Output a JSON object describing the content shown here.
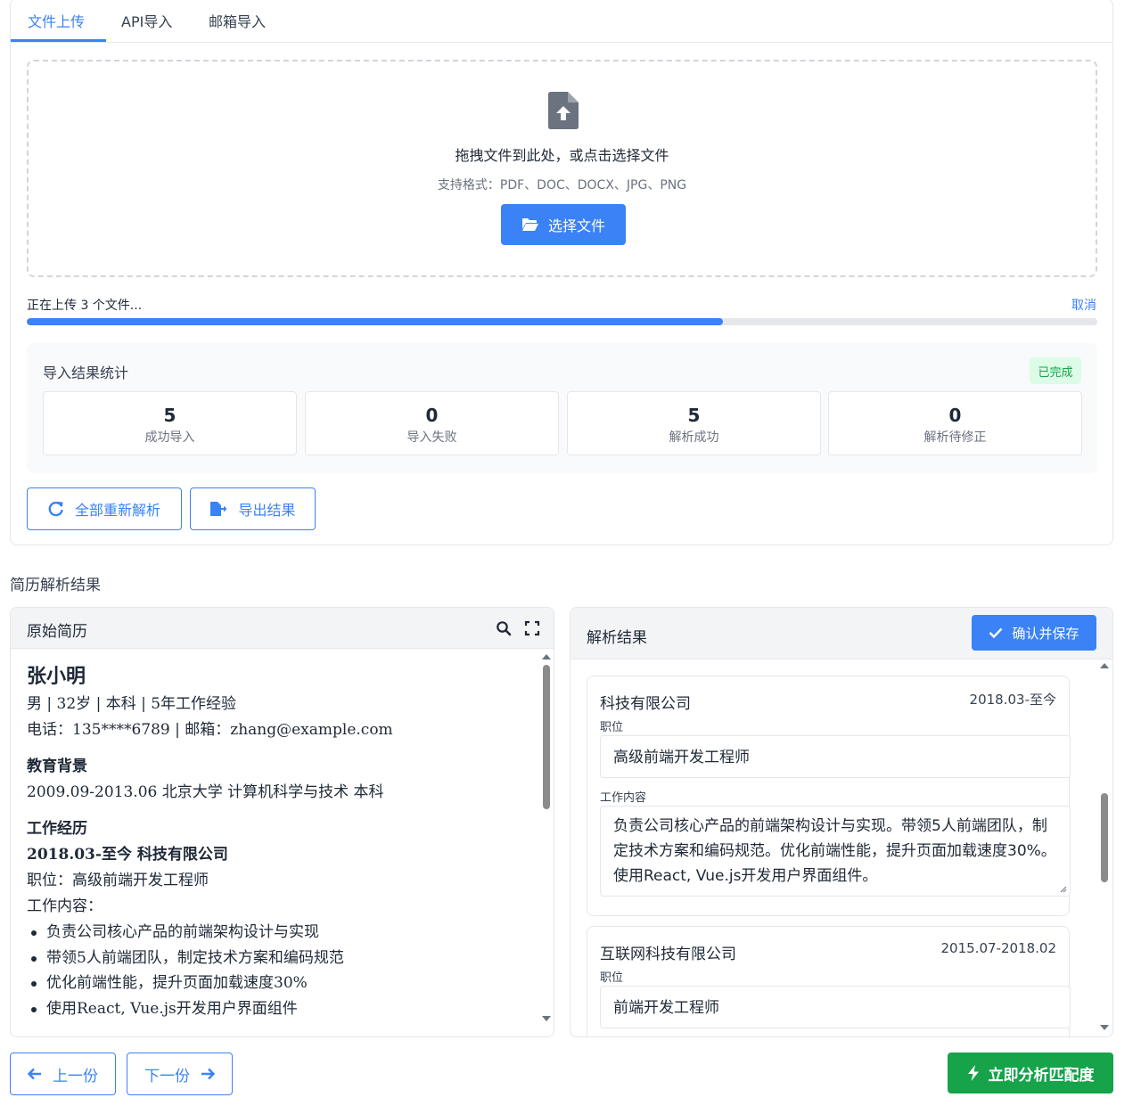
{
  "tabs": [
    {
      "label": "文件上传",
      "active": true
    },
    {
      "label": "API导入",
      "active": false
    },
    {
      "label": "邮箱导入",
      "active": false
    }
  ],
  "upload": {
    "title": "拖拽文件到此处，或点击选择文件",
    "formats": "支持格式：PDF、DOC、DOCX、JPG、PNG",
    "button_label": "选择文件",
    "icon": "file-upload-icon"
  },
  "progress": {
    "label": "正在上传 3 个文件...",
    "cancel_label": "取消",
    "value": 0.65
  },
  "stats": {
    "title": "导入结果统计",
    "badge": "已完成",
    "items": [
      {
        "value": "5",
        "label": "成功导入"
      },
      {
        "value": "0",
        "label": "导入失败"
      },
      {
        "value": "5",
        "label": "解析成功"
      },
      {
        "value": "0",
        "label": "解析待修正"
      }
    ]
  },
  "actions": {
    "reparse_label": "全部重新解析",
    "export_label": "导出结果"
  },
  "results": {
    "section_title": "简历解析结果",
    "original": {
      "title": "原始简历",
      "name": "张小明",
      "summary": "男 | 32岁 | 本科 | 5年工作经验",
      "contact": "电话：135****6789 | 邮箱：zhang@example.com",
      "education_heading": "教育背景",
      "education": "2009.09-2013.06 北京大学 计算机科学与技术 本科",
      "work_heading": "工作经历",
      "work_title": "2018.03-至今 科技有限公司",
      "position_line": "职位：高级前端开发工程师",
      "content_heading": "工作内容：",
      "bullets": [
        "负责公司核心产品的前端架构设计与实现",
        "带领5人前端团队，制定技术方案和编码规范",
        "优化前端性能，提升页面加载速度30%",
        "使用React, Vue.js开发用户界面组件"
      ]
    },
    "parsed": {
      "title": "解析结果",
      "confirm_label": "确认并保存",
      "entries": [
        {
          "company": "科技有限公司",
          "date": "2018.03-至今",
          "position_label": "职位",
          "position": "高级前端开发工程师",
          "content_label": "工作内容",
          "content": "负责公司核心产品的前端架构设计与实现。带领5人前端团队，制定技术方案和编码规范。优化前端性能，提升页面加载速度30%。使用React, Vue.js开发用户界面组件。"
        },
        {
          "company": "互联网科技有限公司",
          "date": "2015.07-2018.02",
          "position_label": "职位",
          "position": "前端开发工程师"
        }
      ]
    }
  },
  "footer": {
    "prev_label": "上一份",
    "next_label": "下一份",
    "analyze_label": "立即分析匹配度"
  },
  "colors": {
    "primary": "#3b82f6",
    "success": "#16a34a",
    "success_bg": "#dcfce7"
  }
}
